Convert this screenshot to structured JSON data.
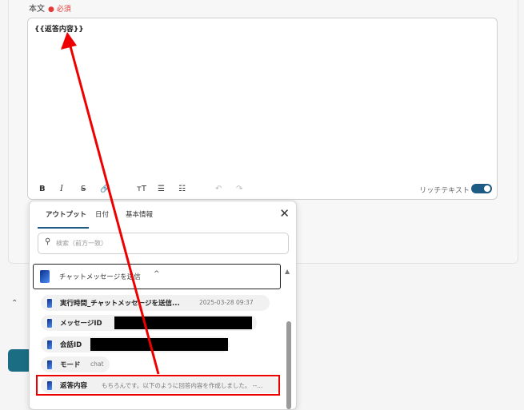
{
  "form": {
    "label": "本文",
    "required": "必須",
    "editor_content": "{{返答内容}}"
  },
  "toolbar": {
    "bold": "B",
    "italic": "I",
    "strike": "S",
    "link": "🔗",
    "textsize": "тT",
    "bullet": "☰",
    "ordered": "☷",
    "undo": "↶",
    "redo": "↷",
    "rich_text_label": "リッチテキスト",
    "rich_text_on": true
  },
  "popover": {
    "tabs": [
      "アウトプット",
      "日付",
      "基本情報"
    ],
    "active_tab": 0,
    "close": "✕",
    "search_placeholder": "検索（前方一致）",
    "group": {
      "title": "チャットメッセージを送信",
      "chevron": "^"
    },
    "items": [
      {
        "name": "実行時間_チャットメッセージを送信...",
        "value": "2025-03-28 09:37"
      },
      {
        "name": "メッセージID",
        "value": ""
      },
      {
        "name": "会話ID",
        "value": ""
      },
      {
        "name": "モード",
        "value": "chat"
      },
      {
        "name": "返答内容",
        "value": "もちろんです。以下のように回答内容を作成しました。 --..."
      }
    ]
  },
  "colors": {
    "accent": "#1c5c84",
    "highlight": "#e00000"
  }
}
